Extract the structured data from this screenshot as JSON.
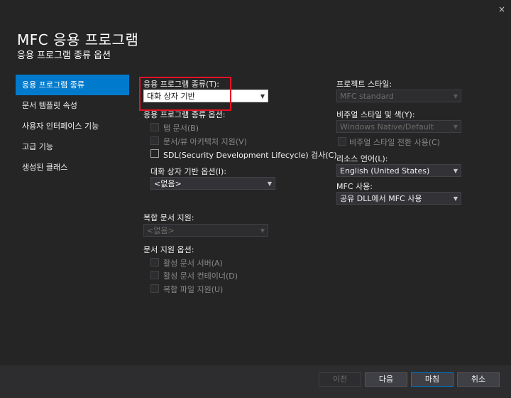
{
  "window": {
    "title": "MFC 응용 프로그램",
    "subtitle": "응용 프로그램 종류 옵션",
    "close_glyph": "×"
  },
  "nav": {
    "items": [
      "응용 프로그램 종류",
      "문서 템플릿 속성",
      "사용자 인터페이스 기능",
      "고급 기능",
      "생성된 클래스"
    ],
    "active_index": 0
  },
  "middle": {
    "app_type_label": "응용 프로그램 종류(T):",
    "app_type_value": "대화 상자 기반",
    "app_type_options_label": "응용 프로그램 종류 옵션:",
    "checkboxes": [
      {
        "label": "탭 문서(B)",
        "checked": false,
        "enabled": false
      },
      {
        "label": "문서/뷰 아키텍처 지원(V)",
        "checked": false,
        "enabled": false
      },
      {
        "label": "SDL(Security Development Lifecycle) 검사(C)",
        "checked": false,
        "enabled": true
      }
    ],
    "dialog_options_label": "대화 상자 기반 옵션(I):",
    "dialog_options_value": "<없음>",
    "compound_label": "복합 문서 지원:",
    "compound_value": "<없음>",
    "doc_support_label": "문서 지원 옵션:",
    "doc_support_checkboxes": [
      {
        "label": "활성 문서 서버(A)",
        "checked": false,
        "enabled": false
      },
      {
        "label": "활성 문서 컨테이너(D)",
        "checked": false,
        "enabled": false
      },
      {
        "label": "복합 파일 지원(U)",
        "checked": false,
        "enabled": false
      }
    ]
  },
  "right": {
    "project_style_label": "프로젝트 스타일:",
    "project_style_value": "MFC standard",
    "visual_style_label": "비주얼 스타일 및 색(Y):",
    "visual_style_value": "Windows Native/Default",
    "visual_toggle_label": "비주얼 스타일 전환 사용(C)",
    "resource_lang_label": "리소스 언어(L):",
    "resource_lang_value": "English (United States)",
    "mfc_use_label": "MFC 사용:",
    "mfc_use_value": "공유 DLL에서 MFC 사용"
  },
  "buttons": {
    "prev": "이전",
    "next": "다음",
    "finish": "마침",
    "cancel": "취소"
  },
  "colors": {
    "background": "#252526",
    "accent": "#007acc",
    "highlight": "#e81123"
  }
}
